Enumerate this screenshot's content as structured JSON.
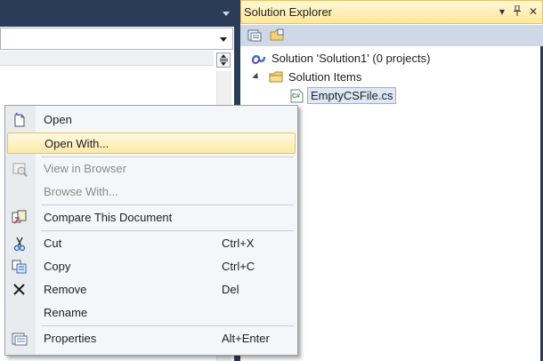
{
  "solution_explorer": {
    "title": "Solution Explorer",
    "title_buttons": {
      "dropdown": "▾",
      "pin": "⊓",
      "close": "✕"
    },
    "toolbar_icons": [
      "properties-icon",
      "show-all-files-icon"
    ],
    "tree": {
      "solution": "Solution 'Solution1' (0 projects)",
      "folder": "Solution Items",
      "file": "EmptyCSFile.cs"
    }
  },
  "context_menu": {
    "items": [
      {
        "label": "Open",
        "shortcut": "",
        "icon": "open-file-icon",
        "state": "normal"
      },
      {
        "label": "Open With...",
        "shortcut": "",
        "icon": "",
        "state": "highlighted"
      },
      {
        "label": "View in Browser",
        "shortcut": "",
        "icon": "view-in-browser-icon",
        "state": "disabled"
      },
      {
        "label": "Browse With...",
        "shortcut": "",
        "icon": "",
        "state": "disabled"
      },
      {
        "label": "Compare This Document",
        "shortcut": "",
        "icon": "compare-icon",
        "state": "normal"
      },
      {
        "label": "Cut",
        "shortcut": "Ctrl+X",
        "icon": "scissors-icon",
        "state": "normal"
      },
      {
        "label": "Copy",
        "shortcut": "Ctrl+C",
        "icon": "copy-icon",
        "state": "normal"
      },
      {
        "label": "Remove",
        "shortcut": "Del",
        "icon": "remove-x-icon",
        "state": "normal"
      },
      {
        "label": "Rename",
        "shortcut": "",
        "icon": "",
        "state": "normal"
      },
      {
        "label": "Properties",
        "shortcut": "Alt+Enter",
        "icon": "properties-icon",
        "state": "normal"
      }
    ]
  },
  "colors": {
    "chrome_dark": "#2b3c59",
    "title_highlight": "#ffe89a",
    "menu_highlight": "#fde9a7"
  }
}
